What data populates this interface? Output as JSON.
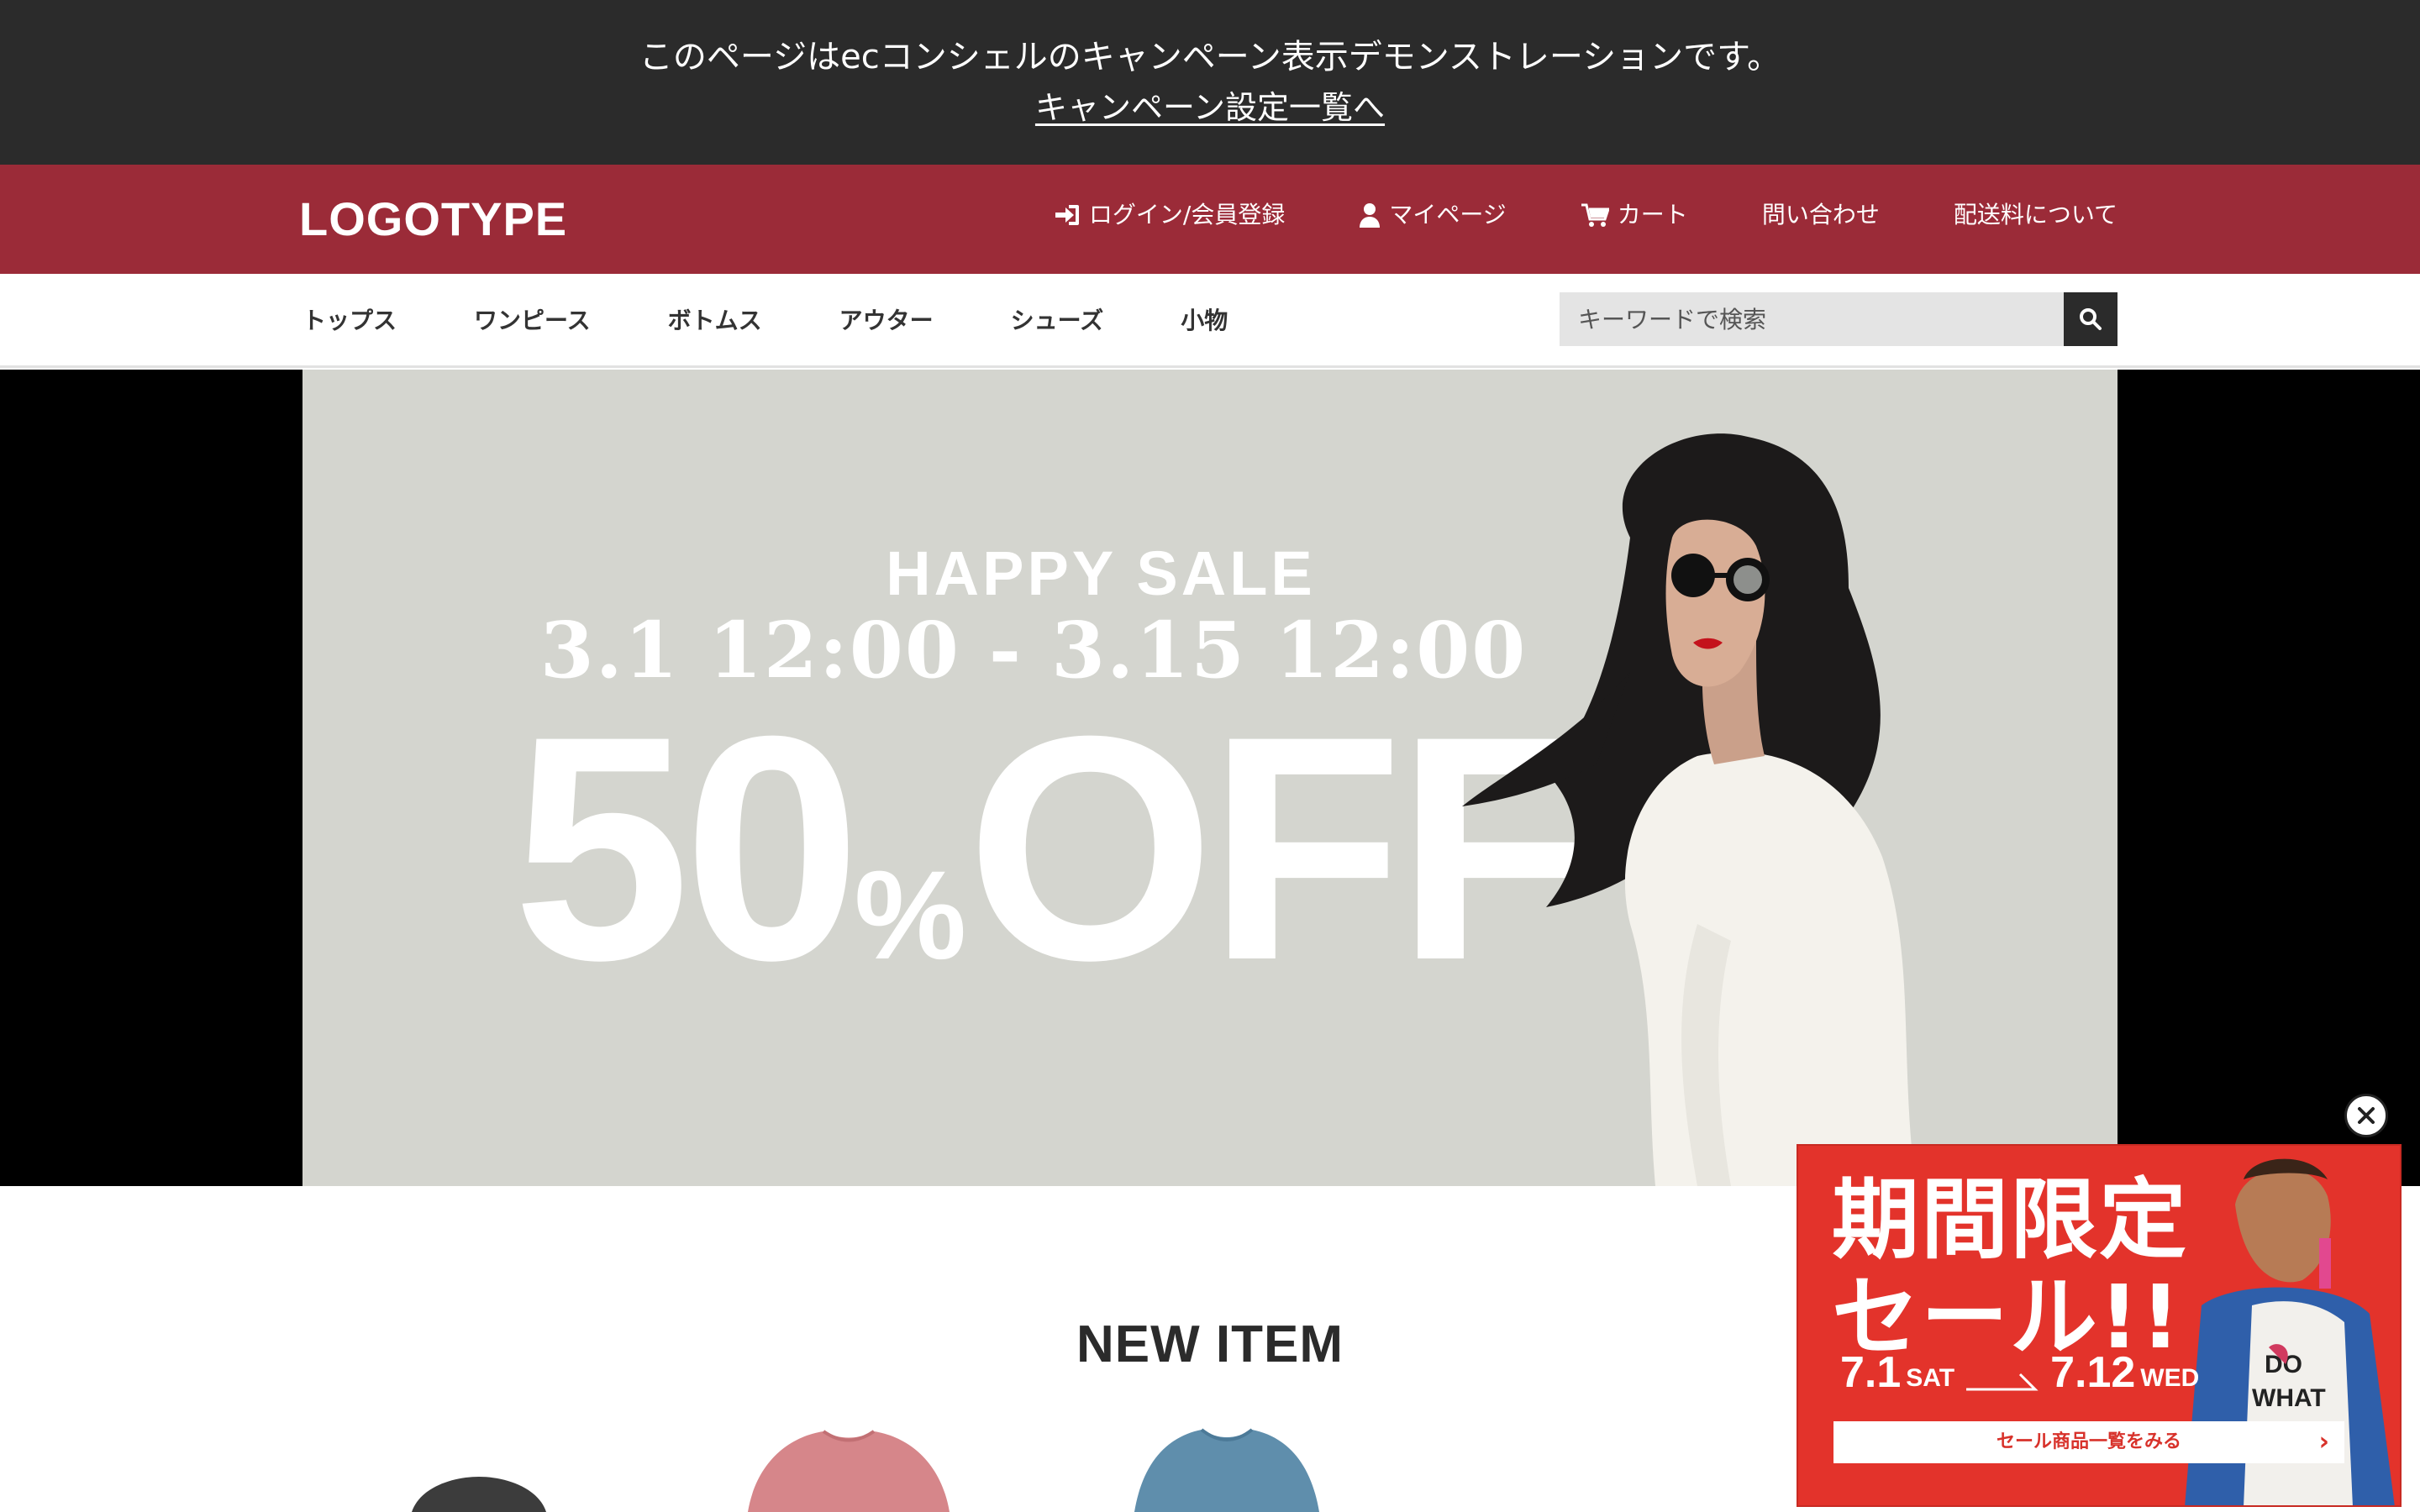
{
  "notice": {
    "message": "このページはecコンシェルのキャンペーン表示デモンストレーションです。",
    "link_label": "キャンペーン設定一覧へ"
  },
  "header": {
    "logo": "LOGOTYPE",
    "brand_color": "#9b2b38",
    "nav": [
      {
        "label": "ログイン/会員登録",
        "icon": "login-icon"
      },
      {
        "label": "マイページ",
        "icon": "user-icon"
      },
      {
        "label": "カート",
        "icon": "cart-icon"
      },
      {
        "label": "問い合わせ",
        "icon": ""
      },
      {
        "label": "配送料について",
        "icon": ""
      }
    ]
  },
  "categories": [
    "トップス",
    "ワンピース",
    "ボトムス",
    "アウター",
    "シューズ",
    "小物"
  ],
  "search": {
    "placeholder": "キーワードで検索",
    "icon": "search-icon"
  },
  "hero": {
    "title": "HAPPY SALE",
    "dates": "3.1 12:00 - 3.15 12:00",
    "discount_number": "50",
    "discount_pct": "%",
    "discount_word": "OFF",
    "background": "#d4d5cf"
  },
  "section": {
    "title": "NEW ITEM"
  },
  "popup": {
    "title_line1": "期間限定",
    "title_line2": "セール!!",
    "start_date": "7.1",
    "start_dow": "SAT",
    "end_date": "7.12",
    "end_dow": "WED",
    "button_label": "セール商品一覧をみる",
    "background": "#e3332b",
    "close_icon": "close-icon"
  }
}
